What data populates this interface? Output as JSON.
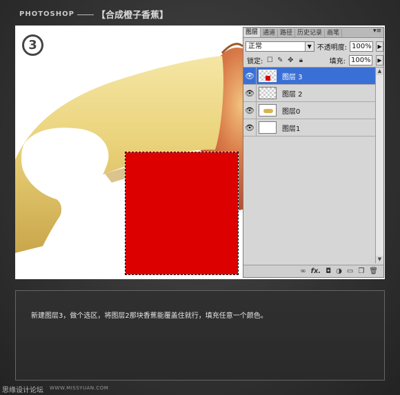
{
  "header": {
    "brand": "PHOTOSHOP",
    "subtitle": "【合成橙子香蕉】"
  },
  "canvas": {
    "step_number": "3",
    "fill_color": "#dd0000"
  },
  "layers_panel": {
    "tabs": [
      "图层",
      "通道",
      "路径",
      "历史记录",
      "画笔"
    ],
    "menu_glyph": "▾≡",
    "blend_mode": "正常",
    "opacity_label": "不透明度:",
    "opacity_value": "100%",
    "lock_label": "锁定:",
    "fill_label": "填充:",
    "fill_value": "100%",
    "layers": [
      {
        "name": "图层 3",
        "selected": true,
        "thumb": "red-rectangle"
      },
      {
        "name": "图层 2",
        "selected": false,
        "thumb": "transparent"
      },
      {
        "name": "图层0",
        "selected": false,
        "thumb": "banana"
      },
      {
        "name": "图层1",
        "selected": false,
        "thumb": "white"
      }
    ],
    "footer_fx": "fx."
  },
  "description": "新建图层3，做个选区，将图层2那块香蕉能覆盖住就行，填充任意一个颜色。",
  "watermark": {
    "left": "思缘设计论坛",
    "right": "WWW.MISSYUAN.COM"
  }
}
